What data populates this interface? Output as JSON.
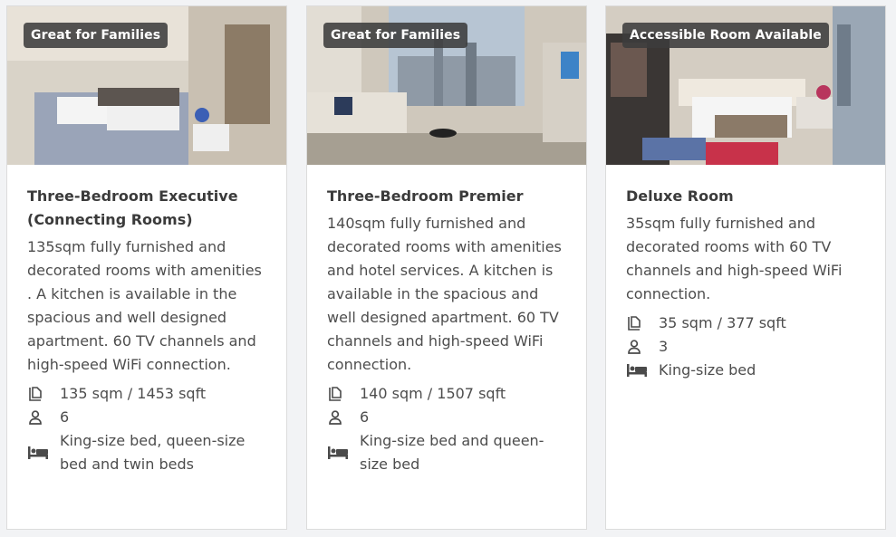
{
  "rooms": [
    {
      "badge": "Great for Families",
      "title": "Three-Bedroom Executive (Connecting Rooms)",
      "description": "135sqm fully furnished and decorated rooms with amenities . A kitchen is available in the spacious and well designed apartment. 60 TV channels and high-speed WiFi connection.",
      "size": "135 sqm / 1453 sqft",
      "guests": "6",
      "beds": "King-size bed, queen-size bed and twin beds"
    },
    {
      "badge": "Great for Families",
      "title": "Three-Bedroom Premier",
      "description": "140sqm fully furnished and decorated rooms with amenities and hotel services. A kitchen is available in the spacious and well designed apartment. 60 TV channels and high-speed WiFi connection.",
      "size": "140 sqm / 1507 sqft",
      "guests": "6",
      "beds": "King-size bed and queen-size bed"
    },
    {
      "badge": "Accessible Room Available",
      "title": "Deluxe Room",
      "description": "35sqm fully furnished and decorated rooms with 60 TV channels and high-speed WiFi connection.",
      "size": "35 sqm / 377 sqft",
      "guests": "3",
      "beds": "King-size bed"
    }
  ],
  "icons": {
    "size": "floor-area-icon",
    "guests": "person-icon",
    "beds": "bed-icon"
  }
}
